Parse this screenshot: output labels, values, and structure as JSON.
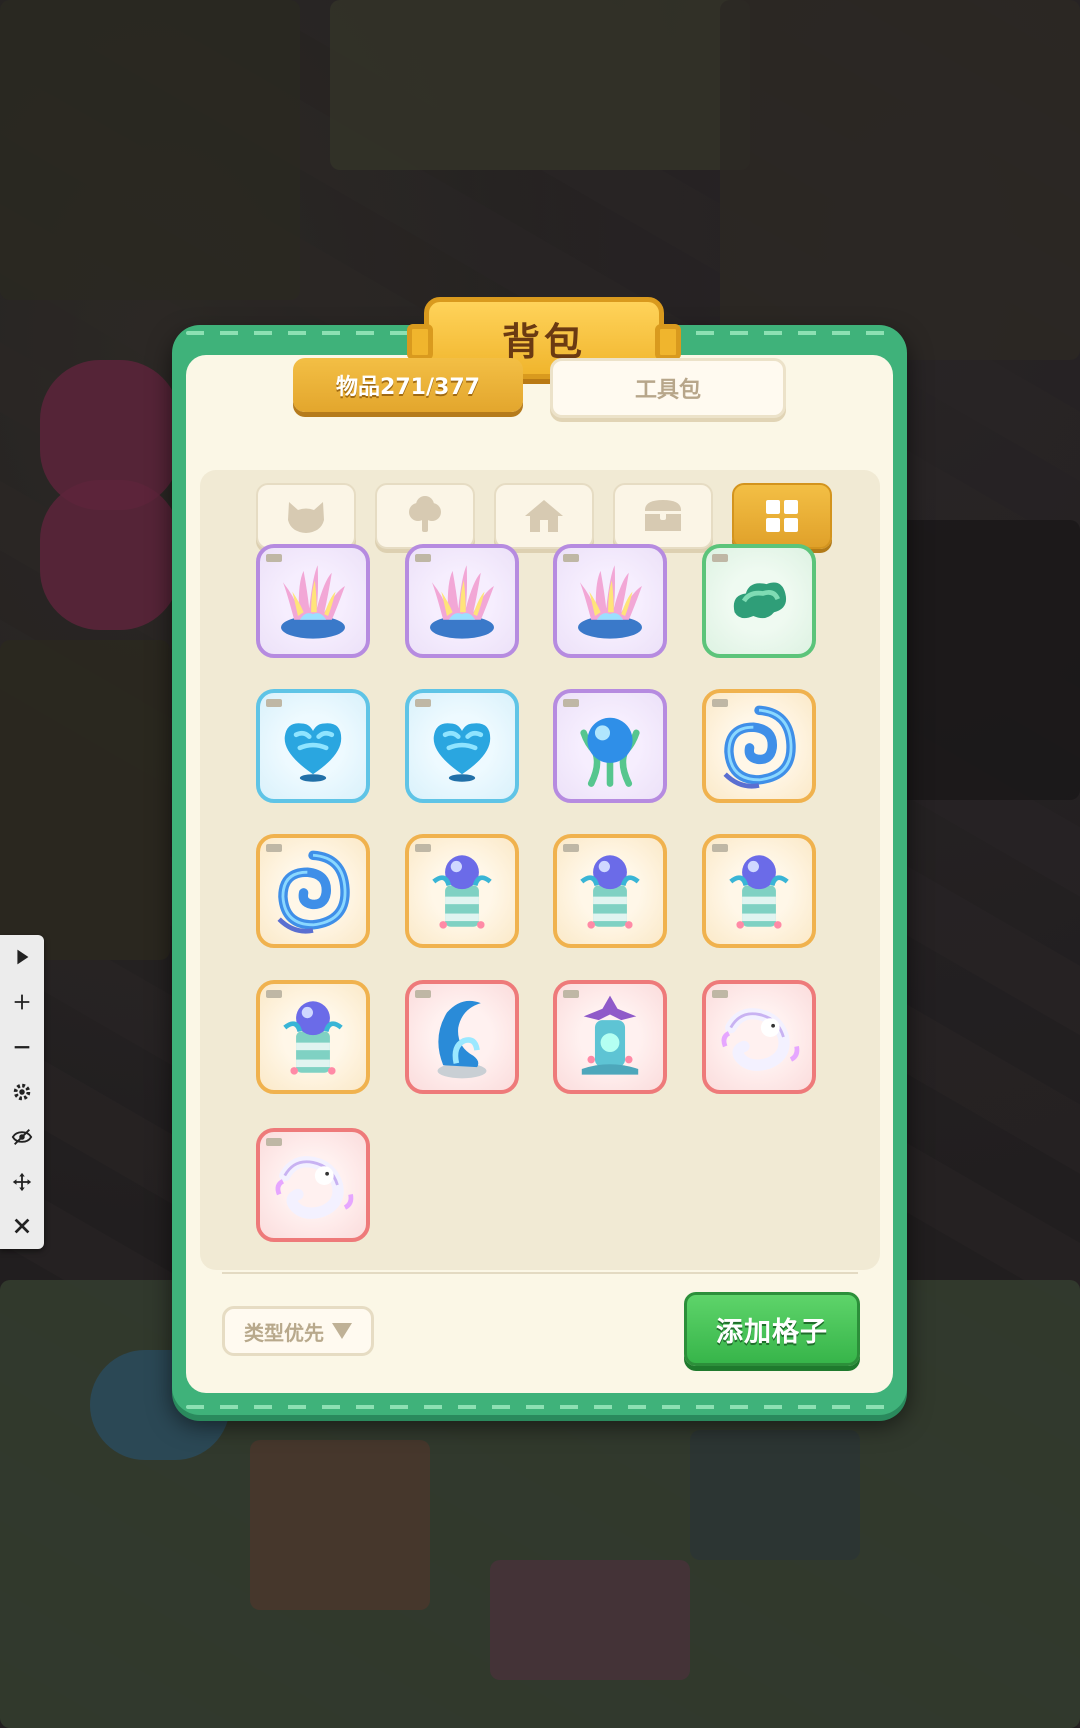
{
  "panel": {
    "title": "背包"
  },
  "tabs": [
    {
      "label": "物品271/377",
      "active": true
    },
    {
      "label": "工具包",
      "active": false
    }
  ],
  "categories": [
    {
      "icon": "cat-head-icon"
    },
    {
      "icon": "tree-icon"
    },
    {
      "icon": "house-icon"
    },
    {
      "icon": "treasure-chest-icon"
    },
    {
      "icon": "grid-icon",
      "active": true
    }
  ],
  "items": [
    {
      "icon": "anemone-coral-icon",
      "rarity": "purple"
    },
    {
      "icon": "anemone-coral-icon",
      "rarity": "purple"
    },
    {
      "icon": "anemone-coral-starfish-icon",
      "rarity": "purple"
    },
    {
      "icon": "green-coral-stone-icon",
      "rarity": "green"
    },
    {
      "icon": "blue-heart-coral-icon",
      "rarity": "blue"
    },
    {
      "icon": "blue-heart-coral-icon",
      "rarity": "blue"
    },
    {
      "icon": "coral-orb-lamp-icon",
      "rarity": "purple"
    },
    {
      "icon": "wave-swirl-arch-icon",
      "rarity": "orange"
    },
    {
      "icon": "wave-swirl-arch-icon",
      "rarity": "orange"
    },
    {
      "icon": "orb-pillar-icon",
      "rarity": "orange"
    },
    {
      "icon": "orb-pillar-icon",
      "rarity": "orange"
    },
    {
      "icon": "orb-pillar-icon",
      "rarity": "orange"
    },
    {
      "icon": "orb-pillar-icon",
      "rarity": "orange"
    },
    {
      "icon": "wave-fountain-icon",
      "rarity": "red"
    },
    {
      "icon": "coral-shrine-icon",
      "rarity": "red"
    },
    {
      "icon": "white-dragon-icon",
      "rarity": "red"
    },
    {
      "icon": "white-dragon-icon",
      "rarity": "red"
    }
  ],
  "footer": {
    "sort_label": "类型优先",
    "add_label": "添加格子"
  },
  "toolbar": [
    "play-icon",
    "zoom-in-icon",
    "zoom-out-icon",
    "gear-icon",
    "hide-eye-icon",
    "move-icon",
    "close-icon"
  ],
  "colors": {
    "panel_green": "#3fb27a",
    "accent_gold": "#f0b52d",
    "button_green": "#37b54a"
  }
}
